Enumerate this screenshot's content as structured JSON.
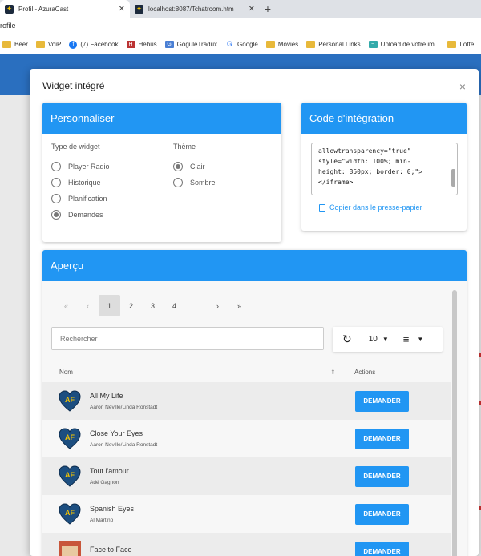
{
  "browser": {
    "tabs": [
      {
        "title": "Profil - AzuraCast",
        "active": true
      },
      {
        "title": "localhost:8087/Tchatroom.htm",
        "active": false
      }
    ],
    "address": "rofile",
    "bookmarks": [
      {
        "label": "Beer",
        "icon": "folder-icon"
      },
      {
        "label": "VoiP",
        "icon": "folder-icon"
      },
      {
        "label": "(7) Facebook",
        "icon": "facebook-icon"
      },
      {
        "label": "Hebus",
        "icon": "hebus-icon"
      },
      {
        "label": "GoguleTradux",
        "icon": "translate-icon"
      },
      {
        "label": "Google",
        "icon": "google-icon"
      },
      {
        "label": "Movies",
        "icon": "folder-icon"
      },
      {
        "label": "Personal Links",
        "icon": "folder-icon"
      },
      {
        "label": "Upload de votre im...",
        "icon": "upload-icon"
      },
      {
        "label": "Lotte",
        "icon": "folder-icon"
      }
    ]
  },
  "modal": {
    "title": "Widget intégré",
    "close": "×",
    "customize": {
      "header": "Personnaliser",
      "widget_type_label": "Type de widget",
      "widget_types": [
        {
          "label": "Player Radio",
          "checked": false
        },
        {
          "label": "Historique",
          "checked": false
        },
        {
          "label": "Planification",
          "checked": false
        },
        {
          "label": "Demandes",
          "checked": true
        }
      ],
      "theme_label": "Thème",
      "themes": [
        {
          "label": "Clair",
          "checked": true
        },
        {
          "label": "Sombre",
          "checked": false
        }
      ]
    },
    "embed": {
      "header": "Code d'intégration",
      "code": "allowtransparency=\"true\"\nstyle=\"width: 100%; min-\nheight: 850px; border: 0;\">\n</iframe>",
      "copy_label": "Copier dans le presse-papier"
    },
    "preview": {
      "header": "Aperçu",
      "pagination": [
        "«",
        "‹",
        "1",
        "2",
        "3",
        "4",
        "...",
        "›",
        "»"
      ],
      "active_page": "1",
      "search_placeholder": "Rechercher",
      "per_page": "10",
      "columns": {
        "name": "Nom",
        "actions": "Actions"
      },
      "rows": [
        {
          "title": "All My Life",
          "artist": "Aaron Neville/Linda Ronstadt",
          "action": "DEMANDER"
        },
        {
          "title": "Close Your Eyes",
          "artist": "Aaron Neville/Linda Ronstadt",
          "action": "DEMANDER"
        },
        {
          "title": "Tout l'amour",
          "artist": "Adé Gagnon",
          "action": "DEMANDER"
        },
        {
          "title": "Spanish Eyes",
          "artist": "Al Martino",
          "action": "DEMANDER"
        },
        {
          "title": "Face to Face",
          "artist": "",
          "action": "DEMANDER"
        }
      ]
    }
  },
  "colors": {
    "accent": "#2196f3",
    "brand_bar": "#2a6fbf"
  }
}
